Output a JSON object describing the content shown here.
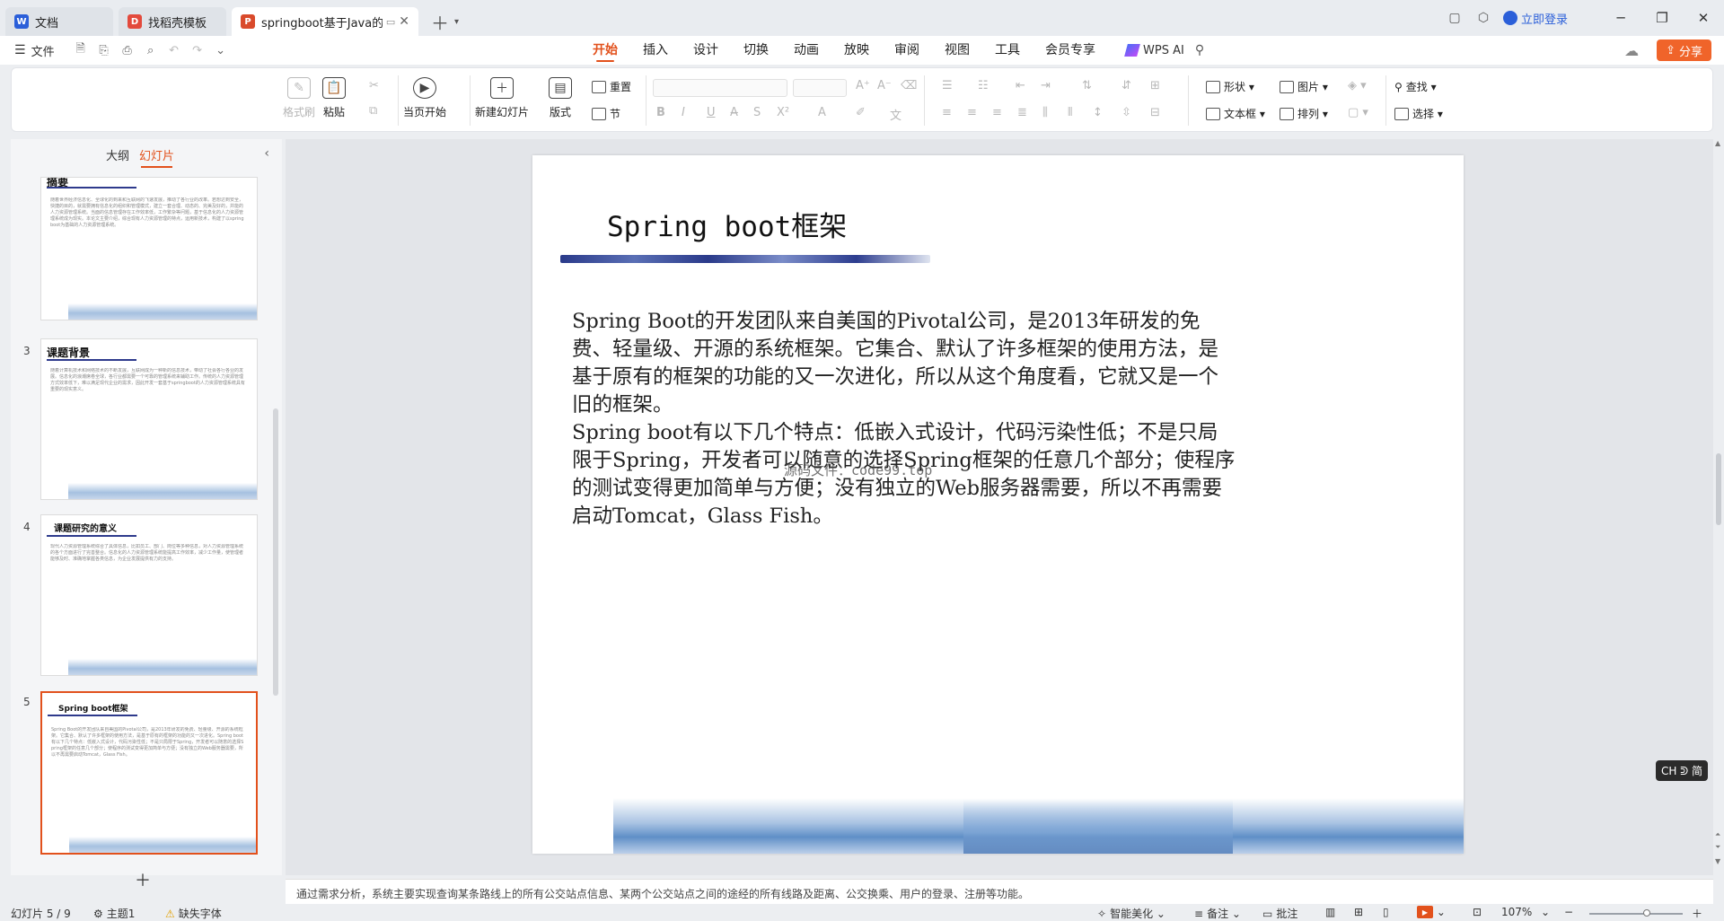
{
  "tabs": [
    {
      "label": "文档",
      "icon": "docs-icon",
      "color": "#2b5fd9"
    },
    {
      "label": "找稻壳模板",
      "icon": "docer-icon",
      "color": "#e34a3c"
    },
    {
      "label": "springboot基于Java的人力",
      "icon": "ppt-icon",
      "color": "#d94a2b"
    }
  ],
  "titlebar": {
    "login": "立即登录"
  },
  "menubar": {
    "file": "文件",
    "tabs": [
      "开始",
      "插入",
      "设计",
      "切换",
      "动画",
      "放映",
      "审阅",
      "视图",
      "工具",
      "会员专享"
    ],
    "active_tab": "开始",
    "wps_ai": "WPS AI",
    "share": "分享"
  },
  "ribbon": {
    "format_painter": "格式刷",
    "paste": "粘贴",
    "play_from_current": "当页开始",
    "new_slide": "新建幻灯片",
    "layout": "版式",
    "reset": "重置",
    "section": "节",
    "shape": "形状",
    "picture": "图片",
    "find": "查找",
    "textbox": "文本框",
    "arrange": "排列",
    "select": "选择"
  },
  "left_panel": {
    "tab_outline": "大纲",
    "tab_slides": "幻灯片",
    "thumbs": [
      {
        "num": "",
        "title": "摘要",
        "body": "随着世界经济信息化、全球化的到来和互联网的飞速发展，推动了各行业的改革。若想达到安全，快捷的目的，就需要拥有信息化的组织和管理模式，建立一套合理、动态的、完美及好的，并能的人力资源管理系统。当面的信息管理存在工作效率低，工作繁杂等问题，基于信息化的人力资源管理系统成为现实。本论文主要介绍，综合现有人力资源管理的特点，运用新技术，构建了以springboot为基础的人力资源管理系统。"
      },
      {
        "num": "3",
        "title": "课题背景",
        "body": "随着计算机技术和网络技术的不断发展，互联网成为一种新的信息技术，带动了社会各行各业的发展。信息化的浪潮席卷全球，各行业都需要一个可靠的管理系统来辅助工作。传统的人力资源管理方式效率低下，难以满足现代企业的需求，因此开发一套基于springboot的人力资源管理系统具有重要的现实意义。"
      },
      {
        "num": "4",
        "title": "课题研究的意义",
        "body": "现代人力资源管理系统综合了具体信息，比如员工、部门、岗位等多种信息，对人力资源管理系统的各个方面进行了完善整合。信息化的人力资源管理系统能提高工作效率，减少工作量，使管理者能够及时、准确地掌握各类信息，为企业发展提供有力的支持。"
      },
      {
        "num": "5",
        "title": "Spring boot框架",
        "body": "Spring Boot的开发团队来自美国的Pivotal公司，是2013年研发的免费、轻量级、开源的系统框架。它集合、默认了许多框架的使用方法，是基于原有的框架的功能的又一次进化。Spring boot有以下几个特点：低嵌入式设计，代码污染性低；不是只局限于Spring，开发者可以随意的选择Spring框架的任意几个部分；使程序的测试变得更加简单与方便；没有独立的Web服务器需要，所以不再需要启动Tomcat，Glass Fish。"
      }
    ]
  },
  "slide": {
    "title": "Spring boot框架",
    "paragraph1": "Spring Boot的开发团队来自美国的Pivotal公司，是2013年研发的免费、轻量级、开源的系统框架。它集合、默认了许多框架的使用方法，是基于原有的框架的功能的又一次进化，所以从这个角度看，它就又是一个旧的框架。",
    "paragraph2": "Spring boot有以下几个特点：低嵌入式设计，代码污染性低；不是只局限于Spring，开发者可以随意的选择Spring框架的任意几个部分；使程序的测试变得更加简单与方便；没有独立的Web服务器需要，所以不再需要启动Tomcat，Glass Fish。",
    "watermark": "源码文件：code99.top"
  },
  "ime": "CH ᕲ 简",
  "notes": "通过需求分析，系统主要实现查询某条路线上的所有公交站点信息、某两个公交站点之间的途经的所有线路及距离、公交换乘、用户的登录、注册等功能。",
  "status": {
    "slide_count": "幻灯片 5 / 9",
    "theme": "主题1",
    "missing_font": "缺失字体",
    "beautify": "智能美化",
    "notes": "备注",
    "comment": "批注",
    "zoom": "107%",
    "zoom_fraction": 0.62
  }
}
